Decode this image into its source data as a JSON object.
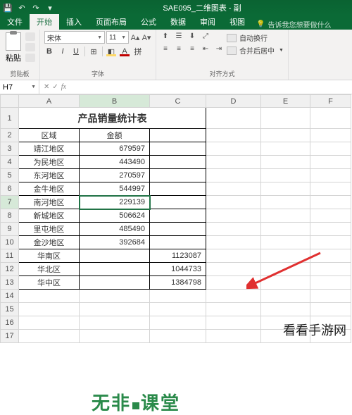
{
  "window": {
    "title": "SAE095_二维图表 - 副"
  },
  "tabs": {
    "file": "文件",
    "home": "开始",
    "insert": "插入",
    "layout": "页面布局",
    "formulas": "公式",
    "data": "数据",
    "review": "审阅",
    "view": "视图",
    "tellme": "告诉我您想要做什么"
  },
  "ribbon": {
    "clipboard": {
      "paste": "粘贴",
      "label": "剪贴板"
    },
    "font": {
      "name": "宋体",
      "size": "11",
      "label": "字体"
    },
    "align": {
      "wrap": "自动换行",
      "merge": "合并后居中",
      "label": "对齐方式"
    }
  },
  "namebox": "H7",
  "formula": "",
  "columns": [
    "A",
    "B",
    "C",
    "D",
    "E",
    "F"
  ],
  "sheet": {
    "title": "产品销量统计表",
    "header": {
      "region": "区域",
      "amount": "金额"
    },
    "rows": [
      {
        "region": "靖江地区",
        "amount": "679597"
      },
      {
        "region": "为民地区",
        "amount": "443490"
      },
      {
        "region": "东河地区",
        "amount": "270597"
      },
      {
        "region": "金牛地区",
        "amount": "544997"
      },
      {
        "region": "南河地区",
        "amount": "229139"
      },
      {
        "region": "新城地区",
        "amount": "506624"
      },
      {
        "region": "里屯地区",
        "amount": "485490"
      },
      {
        "region": "金沙地区",
        "amount": "392684"
      }
    ],
    "summary": [
      {
        "region": "华南区",
        "value": "1123087"
      },
      {
        "region": "华北区",
        "value": "1044733"
      },
      {
        "region": "华中区",
        "value": "1384798"
      }
    ]
  },
  "watermarks": {
    "w1a": "无非",
    "w1b": "课堂",
    "w2": "看看手游网"
  }
}
